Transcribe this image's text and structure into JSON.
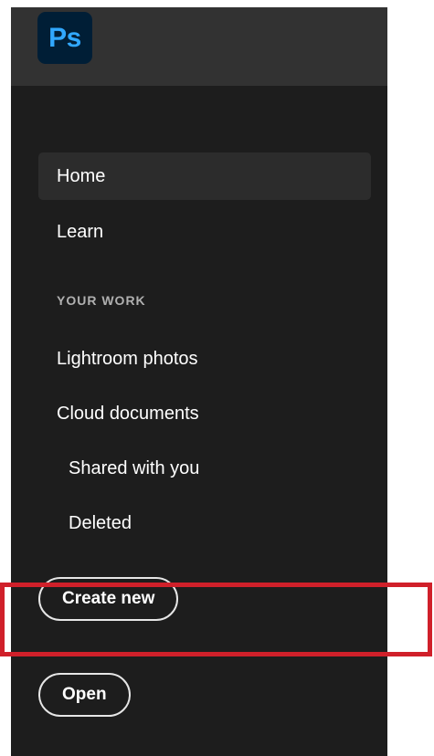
{
  "app": {
    "logo_text": "Ps",
    "logo_bg_color": "#001e36",
    "logo_text_color": "#31a8ff"
  },
  "nav": {
    "items": [
      {
        "label": "Home",
        "active": true
      },
      {
        "label": "Learn",
        "active": false
      }
    ]
  },
  "your_work": {
    "heading": "YOUR WORK",
    "items": [
      {
        "label": "Lightroom photos"
      },
      {
        "label": "Cloud documents"
      },
      {
        "label": "Shared with you"
      },
      {
        "label": "Deleted"
      }
    ]
  },
  "actions": {
    "create_new_label": "Create new",
    "open_label": "Open"
  },
  "colors": {
    "panel_bg": "#1d1d1d",
    "topbar_bg": "#323232",
    "active_item_bg": "#2c2c2c",
    "highlight_border": "#d0202a"
  }
}
